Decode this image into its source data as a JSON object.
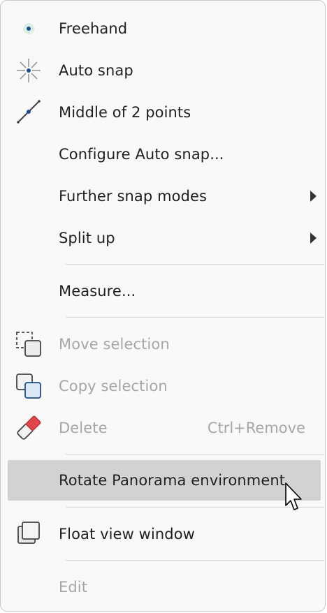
{
  "menu": {
    "items": {
      "freehand": {
        "label": "Freehand",
        "icon": "freehand-icon"
      },
      "auto_snap": {
        "label": "Auto snap",
        "icon": "auto-snap-icon"
      },
      "middle_of_2_points": {
        "label": "Middle of 2 points",
        "icon": "middle-of-points-icon"
      },
      "configure_auto_snap": {
        "label": "Configure Auto snap..."
      },
      "further_snap_modes": {
        "label": "Further snap modes"
      },
      "split_up": {
        "label": "Split up"
      },
      "measure": {
        "label": "Measure..."
      },
      "move_selection": {
        "label": "Move selection",
        "icon": "move-selection-icon",
        "disabled": true
      },
      "copy_selection": {
        "label": "Copy selection",
        "icon": "copy-selection-icon",
        "disabled": true
      },
      "delete": {
        "label": "Delete",
        "shortcut": "Ctrl+Remove",
        "icon": "eraser-icon",
        "disabled": true
      },
      "rotate_panorama": {
        "label": "Rotate Panorama environment",
        "highlighted": true
      },
      "float_view_window": {
        "label": "Float view window",
        "icon": "float-window-icon"
      },
      "edit": {
        "label": "Edit",
        "disabled": true
      }
    }
  },
  "colors": {
    "accent": "#1b4f91",
    "disabled_text": "#a6a6a6",
    "highlight_bg": "#d2d2d2",
    "eraser_red": "#e0454a"
  }
}
